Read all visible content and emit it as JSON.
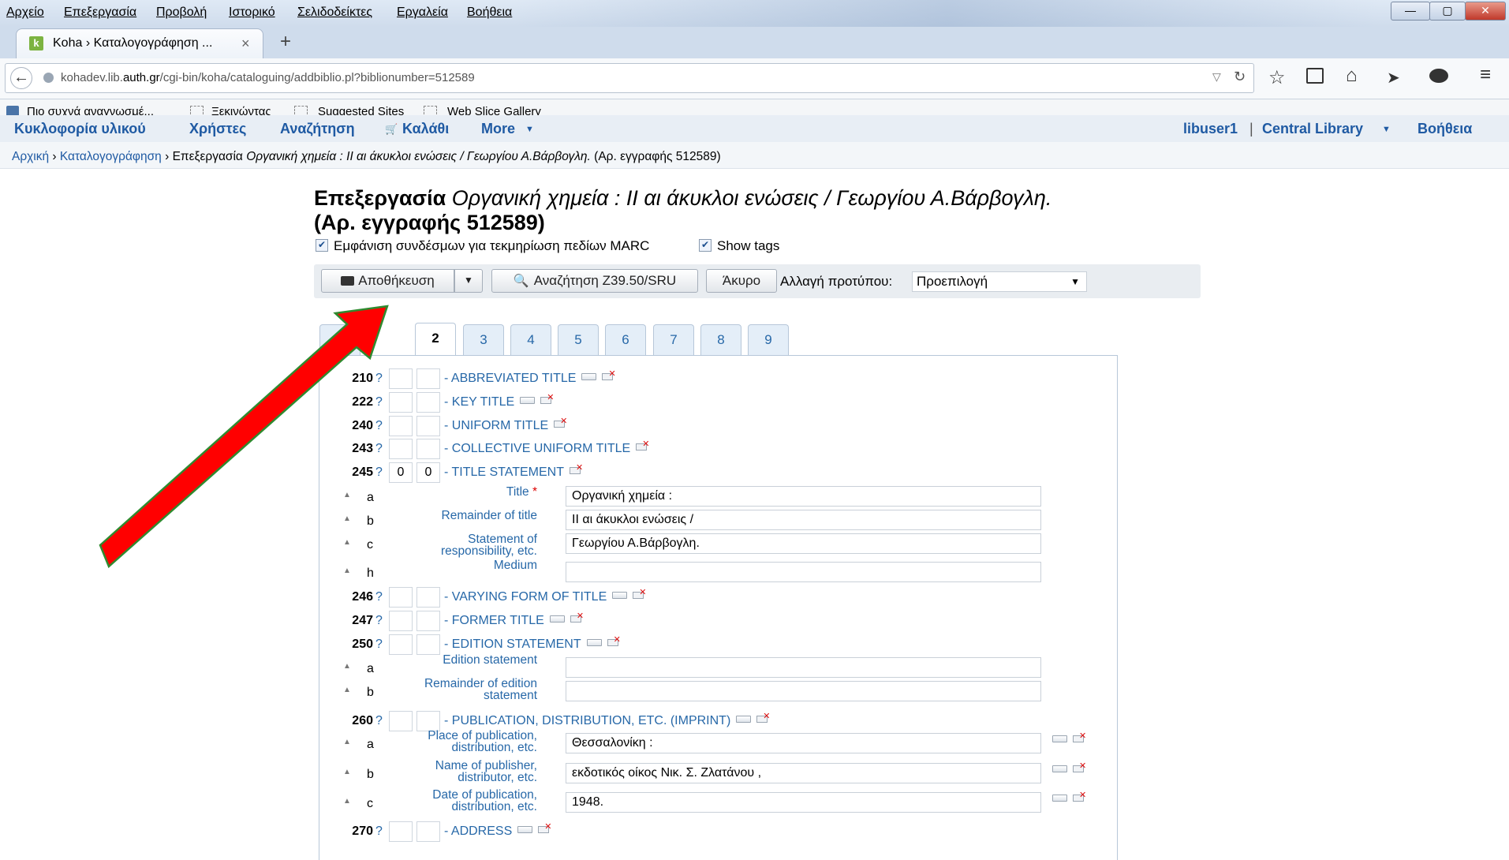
{
  "browser": {
    "menu": [
      "Αρχείο",
      "Επεξεργασία",
      "Προβολή",
      "Ιστορικό",
      "Σελιδοδείκτες",
      "Εργαλεία",
      "Βοήθεια"
    ],
    "window_buttons": [
      "—",
      "▢",
      "✕"
    ],
    "tab_title": "Koha › Καταλογογράφηση ...",
    "tab_close": "×",
    "new_tab": "+",
    "url_host_prefix": "kohadev.lib.",
    "url_host_bold": "auth.gr",
    "url_path": "/cgi-bin/koha/cataloguing/addbiblio.pl?biblionumber=512589",
    "bookmarks": [
      "Πιο συχνά αναγνωσμέ...",
      "Ξεκινώντας",
      "Suggested Sites",
      "Web Slice Gallery"
    ]
  },
  "koha_nav": {
    "left": [
      "Κυκλοφορία υλικού",
      "Χρήστες",
      "Αναζήτηση",
      "Καλάθι",
      "More"
    ],
    "user": "libuser1",
    "sep": "|",
    "library": "Central Library",
    "help": "Βοήθεια"
  },
  "breadcrumb": {
    "home": "Αρχική",
    "sep": "›",
    "cataloguing": "Καταλογογράφηση",
    "edit": "Επεξεργασία",
    "title": "Οργανική χημεία : II αι άκυκλοι ενώσεις / Γεωργίου Α.Βάρβογλη.",
    "record": "(Αρ. εγγραφής 512589)"
  },
  "heading": {
    "edit": "Επεξεργασία",
    "title": "Οργανική χημεία : II αι άκυκλοι ενώσεις / Γεωργίου Α.Βάρβογλη.",
    "record": "(Αρ. εγγραφής 512589)"
  },
  "options": {
    "show_links": "Εμφάνιση συνδέσμων για τεκμηρίωση πεδίων MARC",
    "show_tags": "Show tags"
  },
  "toolbar": {
    "save": "Αποθήκευση",
    "z3950": "Αναζήτηση Z39.50/SRU",
    "cancel": "Άκυρο",
    "template_label": "Αλλαγή προτύπου:",
    "template_value": "Προεπιλογή"
  },
  "tabs": [
    "1",
    "2",
    "3",
    "4",
    "5",
    "6",
    "7",
    "8",
    "9"
  ],
  "fields": {
    "f210": {
      "tag": "210",
      "ind1": "",
      "ind2": "",
      "name": "- ABBREVIATED TITLE"
    },
    "f222": {
      "tag": "222",
      "ind1": "",
      "ind2": "",
      "name": "- KEY TITLE"
    },
    "f240": {
      "tag": "240",
      "ind1": "",
      "ind2": "",
      "name": "- UNIFORM TITLE"
    },
    "f243": {
      "tag": "243",
      "ind1": "",
      "ind2": "",
      "name": "- COLLECTIVE UNIFORM TITLE"
    },
    "f245": {
      "tag": "245",
      "ind1": "0",
      "ind2": "0",
      "name": "- TITLE STATEMENT"
    },
    "f246": {
      "tag": "246",
      "ind1": "",
      "ind2": "",
      "name": "- VARYING FORM OF TITLE"
    },
    "f247": {
      "tag": "247",
      "ind1": "",
      "ind2": "",
      "name": "- FORMER TITLE"
    },
    "f250": {
      "tag": "250",
      "ind1": "",
      "ind2": "",
      "name": "- EDITION STATEMENT"
    },
    "f260": {
      "tag": "260",
      "ind1": "",
      "ind2": "",
      "name": "- PUBLICATION, DISTRIBUTION, ETC. (IMPRINT)"
    },
    "f270": {
      "tag": "270",
      "ind1": "",
      "ind2": "",
      "name": "- ADDRESS"
    }
  },
  "q": "?",
  "up": "▲",
  "sub245": [
    {
      "code": "a",
      "label": "Title",
      "req": "*",
      "value": "Οργανική χημεία :"
    },
    {
      "code": "b",
      "label": "Remainder of title",
      "value": "II αι άκυκλοι ενώσεις /"
    },
    {
      "code": "c",
      "label": "Statement of responsibility, etc.",
      "value": "Γεωργίου Α.Βάρβογλη."
    },
    {
      "code": "h",
      "label": "Medium",
      "value": ""
    }
  ],
  "sub250": [
    {
      "code": "a",
      "label": "Edition statement",
      "value": ""
    },
    {
      "code": "b",
      "label": "Remainder of edition statement",
      "value": ""
    }
  ],
  "sub260": [
    {
      "code": "a",
      "label": "Place of publication, distribution, etc.",
      "value": "Θεσσαλονίκη :"
    },
    {
      "code": "b",
      "label": "Name of publisher, distributor, etc.",
      "value": "εκδοτικός οίκος Νικ. Σ. Ζλατάνου ,"
    },
    {
      "code": "c",
      "label": "Date of publication, distribution, etc.",
      "value": "1948."
    }
  ],
  "colors": {
    "link": "#2768a8",
    "arrow": "#ff0000",
    "arrow_border": "#2f8a2f"
  }
}
